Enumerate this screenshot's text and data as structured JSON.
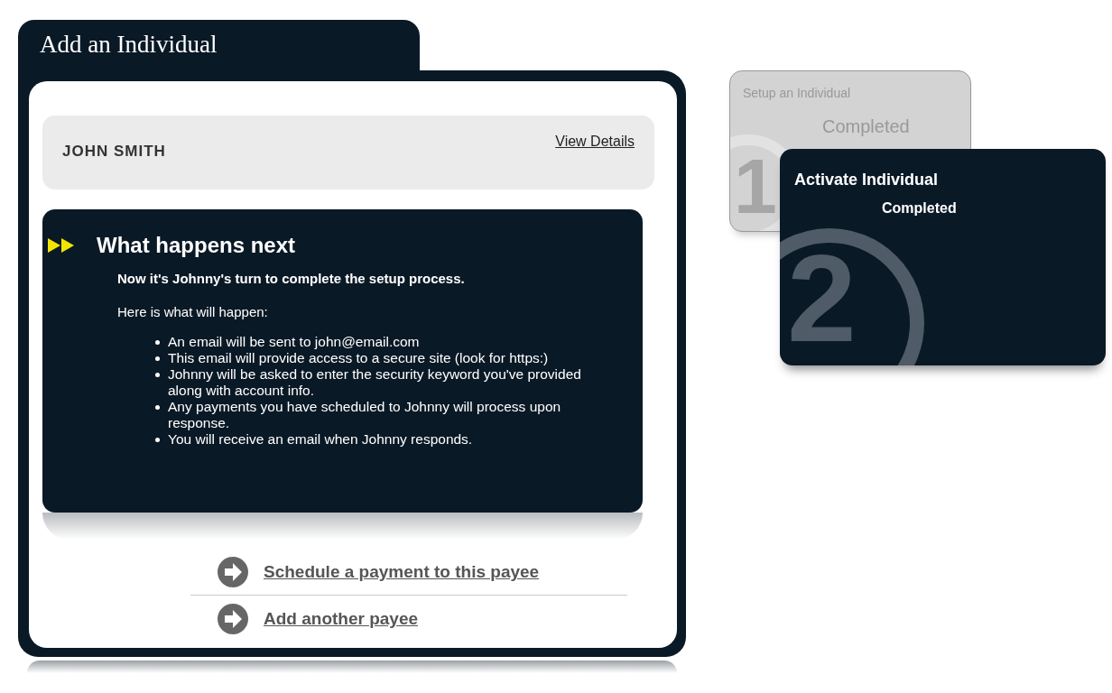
{
  "panel": {
    "title": "Add an Individual"
  },
  "payee": {
    "name": "JOHN SMITH",
    "link": "View Details"
  },
  "next": {
    "title": "What happens next",
    "lead": "Now it's Johnny's turn to complete the setup process.",
    "intro": "Here is what will happen:",
    "items": [
      "An email will be sent to john@email.com",
      "This email will provide access to a secure site (look for https:)",
      "Johnny will be asked to enter the security keyword you've provided along with account info.",
      "Any payments you have scheduled to Johnny will process upon response.",
      "You will receive an email when Johnny responds."
    ]
  },
  "actions": [
    "Schedule a payment to this payee",
    "Add another payee"
  ],
  "steps": [
    {
      "title": "Setup an Individual",
      "status": "Completed",
      "number": "1",
      "selected": false
    },
    {
      "title": "Activate Individual",
      "status": "Completed",
      "number": "2",
      "selected": true
    }
  ]
}
